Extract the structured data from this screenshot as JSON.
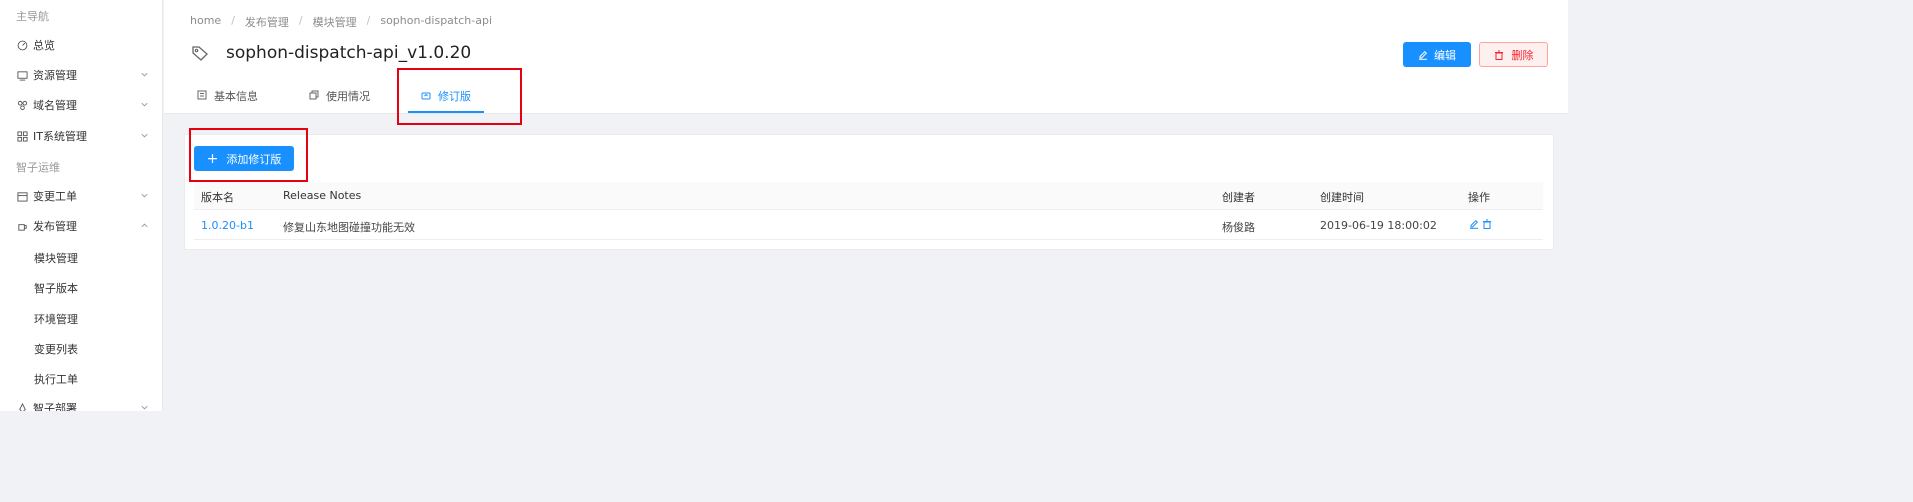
{
  "sidebar": {
    "group_main": "主导航",
    "overview": "总览",
    "resource_mgmt": "资源管理",
    "domain_mgmt": "域名管理",
    "it_system_mgmt": "IT系统管理",
    "group_ops": "智子运维",
    "change_ticket": "变更工单",
    "release_mgmt": "发布管理",
    "sub_items": [
      "模块管理",
      "智子版本",
      "环境管理",
      "变更列表",
      "执行工单"
    ],
    "deploy": "智子部署"
  },
  "breadcrumb": [
    "home",
    "发布管理",
    "模块管理",
    "sophon-dispatch-api"
  ],
  "page": {
    "title": "sophon-dispatch-api_v1.0.20",
    "edit_label": "编辑",
    "delete_label": "删除"
  },
  "tabs": [
    {
      "label": "基本信息",
      "active": false
    },
    {
      "label": "使用情况",
      "active": false
    },
    {
      "label": "修订版",
      "active": true
    }
  ],
  "add_button_label": "添加修订版",
  "table": {
    "columns": [
      "版本名",
      "Release Notes",
      "创建者",
      "创建时间",
      "操作"
    ],
    "rows": [
      {
        "version": "1.0.20-b1",
        "notes": "修复山东地图碰撞功能无效",
        "creator": "杨俊路",
        "created_at": "2019-06-19 18:00:02"
      }
    ]
  },
  "colors": {
    "primary": "#1890ff",
    "danger": "#f5222d",
    "annotation": "#e60012"
  }
}
